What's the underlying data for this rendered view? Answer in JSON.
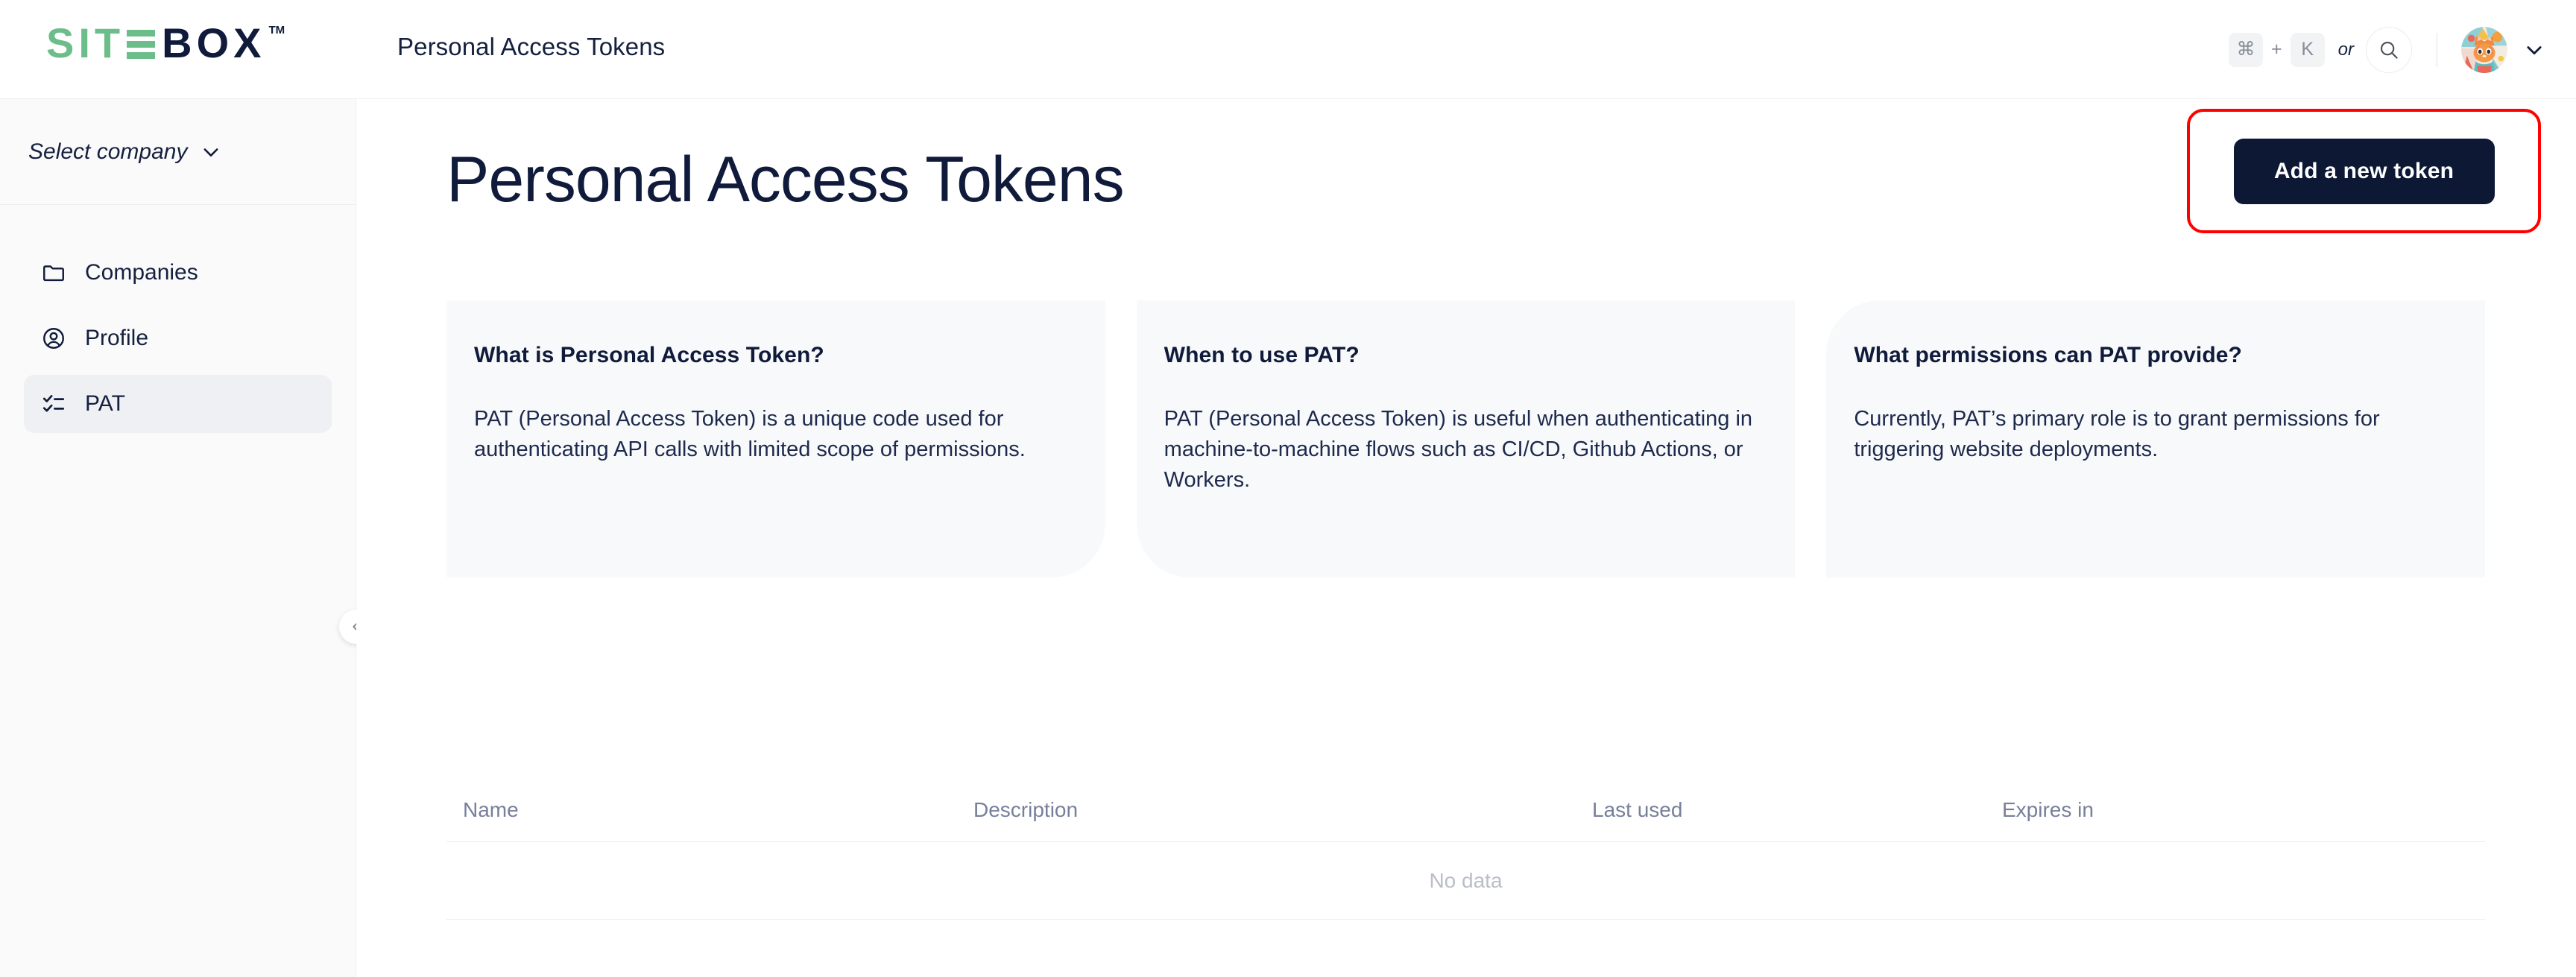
{
  "brand": {
    "logo_green": "SIT",
    "logo_e": "E",
    "logo_dark": "BOX",
    "logo_tm": "TM"
  },
  "topbar": {
    "title": "Personal Access Tokens",
    "shortcut_cmd": "⌘",
    "shortcut_plus": "+",
    "shortcut_key": "K",
    "shortcut_or": "or",
    "search_icon": "search-icon",
    "avatar_icon": "cat-avatar",
    "user_chevron": "chevron-down-icon"
  },
  "sidebar": {
    "company_select_label": "Select company",
    "company_chevron": "chevron-down-icon",
    "items": [
      {
        "label": "Companies",
        "icon": "folder-icon",
        "active": false
      },
      {
        "label": "Profile",
        "icon": "user-circle-icon",
        "active": false
      },
      {
        "label": "PAT",
        "icon": "checklist-icon",
        "active": true
      }
    ],
    "collapse_icon": "chevron-left-icon"
  },
  "main": {
    "page_title": "Personal Access Tokens",
    "add_token_label": "Add a new token",
    "cards": [
      {
        "title": "What is Personal Access Token?",
        "body": "PAT (Personal Access Token) is a unique code used for authenticating API calls with limited scope of permissions."
      },
      {
        "title": "When to use PAT?",
        "body": "PAT (Personal Access Token) is useful when authenticating in machine-to-machine flows such as CI/CD, Github Actions, or Workers."
      },
      {
        "title": "What permissions can PAT provide?",
        "body": "Currently, PAT’s primary role is to grant permissions for triggering website deployments."
      }
    ],
    "table": {
      "columns": [
        "Name",
        "Description",
        "Last used",
        "Expires in"
      ],
      "rows": [],
      "empty_text": "No data"
    }
  },
  "colors": {
    "brand_green": "#6bbd8a",
    "brand_navy": "#101b3b",
    "button_navy": "#0d1835",
    "highlight_red": "#ff0000",
    "card_bg": "#f8f9fa",
    "sidebar_bg": "#fafafa",
    "muted_text": "#77809b"
  }
}
